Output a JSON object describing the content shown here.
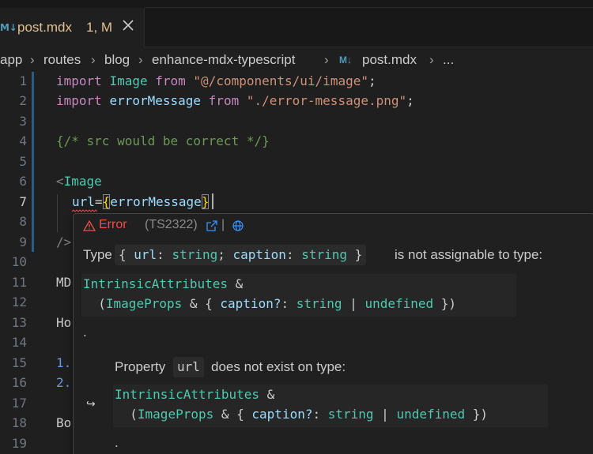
{
  "tab": {
    "icon": "mdx-file-icon",
    "icon_text": "M↓",
    "filename": "post.mdx",
    "badge": "1, M"
  },
  "breadcrumb": {
    "items": [
      "app",
      "routes",
      "blog",
      "enhance-mdx-typescript",
      "post.mdx",
      "..."
    ],
    "file_icon_text": "M↓"
  },
  "editor": {
    "line_numbers": [
      "1",
      "2",
      "3",
      "4",
      "5",
      "6",
      "7",
      "8",
      "9",
      "10",
      "11",
      "12",
      "13",
      "14",
      "15",
      "16",
      "17",
      "18",
      "19"
    ],
    "active_line": "7",
    "lines": {
      "l1": {
        "kw": "import",
        "name": "Image",
        "from": "from",
        "path": "\"@/components/ui/image\"",
        "end": ";"
      },
      "l2": {
        "kw": "import",
        "name": "errorMessage",
        "from": "from",
        "path": "\"./error-message.png\"",
        "end": ";"
      },
      "l4": {
        "open": "{",
        "comment": "/* src would be correct */",
        "close": "}"
      },
      "l6": {
        "lt": "<",
        "tag": "Image"
      },
      "l7": {
        "attr": "url",
        "eq": "=",
        "open": "{",
        "value": "errorMessage",
        "close": "}"
      },
      "l9": "/>",
      "l11": "MD",
      "l13": "Ho",
      "l15": "1.",
      "l16": "2.",
      "l18": "Bo"
    }
  },
  "hover": {
    "title": "Error",
    "code": "(TS2322)",
    "pipe": "|",
    "type_label": "Type",
    "type_chip": "{ url: string; caption: string }",
    "not_assignable": "is not assignable to type:",
    "block1_line1": "IntrinsicAttributes &",
    "block1_line2": "  (ImageProps & { caption?: string | undefined })",
    "dot": ".",
    "property_label": "Property",
    "property_chip": "url",
    "not_exist": "does not exist on type:",
    "block2_line1": "IntrinsicAttributes &",
    "block2_line2": "  (ImageProps & { caption?: string | undefined })",
    "dot2": ".",
    "nested_arrow": "↪"
  },
  "colors": {
    "error": "#f14c4c",
    "modified": "#e2c08d",
    "link": "#3794ff"
  }
}
